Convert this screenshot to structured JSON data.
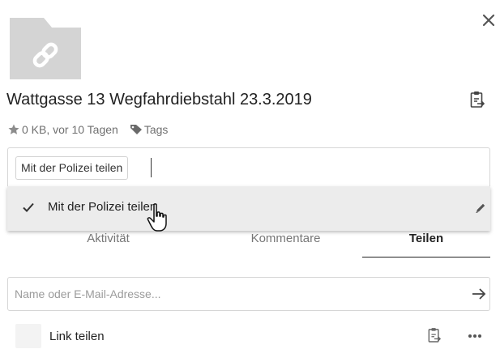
{
  "file": {
    "title": "Wattgasse 13 Wegfahrdiebstahl 23.3.2019",
    "size": "0 KB, vor 10 Tagen",
    "tags_link": "Tags"
  },
  "tag_editor": {
    "chip": "Mit der Polizei teilen",
    "suggestion": "Mit der Polizei teilen"
  },
  "tabs": [
    {
      "label": "Aktivität",
      "active": false
    },
    {
      "label": "Kommentare",
      "active": false
    },
    {
      "label": "Teilen",
      "active": true
    }
  ],
  "share": {
    "placeholder": "Name oder E-Mail-Adresse...",
    "link_label": "Link teilen"
  },
  "colors": {
    "folder": "#d4d4d4",
    "dropdown_bg": "#ececec",
    "text": "#222222",
    "muted": "#707070"
  },
  "icons": [
    "close-icon",
    "link-icon",
    "clipboard-icon",
    "star-icon",
    "tag-icon",
    "checkmark-icon",
    "pencil-icon",
    "arrow-right-icon",
    "more-icon"
  ]
}
